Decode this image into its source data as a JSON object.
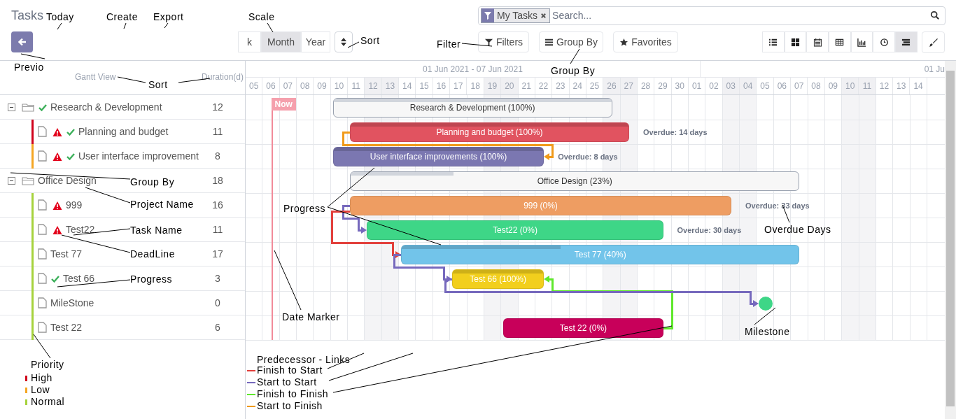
{
  "app_title": "Tasks",
  "callouts": [
    {
      "label": "Today"
    },
    {
      "label": "Create"
    },
    {
      "label": "Export"
    },
    {
      "label": "Scale"
    },
    {
      "label": "Sort"
    },
    {
      "label": "Filter"
    },
    {
      "label": "Group By"
    },
    {
      "label": "Previo"
    },
    {
      "label": "Sort"
    },
    {
      "label": "Group By"
    },
    {
      "label": "Project Name"
    },
    {
      "label": "Task Name"
    },
    {
      "label": "DeadLine"
    },
    {
      "label": "Progress"
    },
    {
      "label": "Progress"
    },
    {
      "label": "Date Marker"
    },
    {
      "label": "Overdue Days"
    },
    {
      "label": "Milestone"
    }
  ],
  "search": {
    "facet": "My Tasks",
    "placeholder": "Search..."
  },
  "scale_buttons": [
    {
      "label": "k",
      "selected": false
    },
    {
      "label": "Month",
      "selected": true
    },
    {
      "label": "Year",
      "selected": false
    }
  ],
  "filter_buttons": [
    {
      "kind": "filter",
      "label": "Filters"
    },
    {
      "kind": "group",
      "label": "Group By"
    },
    {
      "kind": "star",
      "label": "Favorites"
    }
  ],
  "views": [
    {
      "kind": "list",
      "selected": false
    },
    {
      "kind": "kanban",
      "selected": false
    },
    {
      "kind": "calendar",
      "selected": false
    },
    {
      "kind": "pivot",
      "selected": false
    },
    {
      "kind": "graph",
      "selected": false
    },
    {
      "kind": "activity",
      "selected": false
    },
    {
      "kind": "gantt",
      "selected": true
    }
  ],
  "columns": {
    "name": "Gantt View",
    "duration": "Duration(d)"
  },
  "timeline": {
    "ranges": [
      "01 Jun 2021 - 07 Jun 2021",
      "01 Ju"
    ],
    "now_label": "Now",
    "days": [
      {
        "label": "05",
        "weekend": false
      },
      {
        "label": "06",
        "weekend": false
      },
      {
        "label": "07",
        "weekend": false
      },
      {
        "label": "08",
        "weekend": false
      },
      {
        "label": "09",
        "weekend": false
      },
      {
        "label": "10",
        "weekend": false
      },
      {
        "label": "11",
        "weekend": false
      },
      {
        "label": "12",
        "weekend": true
      },
      {
        "label": "13",
        "weekend": true
      },
      {
        "label": "14",
        "weekend": false
      },
      {
        "label": "15",
        "weekend": false
      },
      {
        "label": "16",
        "weekend": false
      },
      {
        "label": "17",
        "weekend": false
      },
      {
        "label": "18",
        "weekend": false
      },
      {
        "label": "19",
        "weekend": true
      },
      {
        "label": "20",
        "weekend": true
      },
      {
        "label": "21",
        "weekend": false
      },
      {
        "label": "22",
        "weekend": false
      },
      {
        "label": "23",
        "weekend": false
      },
      {
        "label": "24",
        "weekend": false
      },
      {
        "label": "25",
        "weekend": false
      },
      {
        "label": "26",
        "weekend": true
      },
      {
        "label": "27",
        "weekend": true
      },
      {
        "label": "28",
        "weekend": false
      },
      {
        "label": "29",
        "weekend": false
      },
      {
        "label": "30",
        "weekend": false
      },
      {
        "label": "01",
        "weekend": false
      },
      {
        "label": "02",
        "weekend": false
      },
      {
        "label": "03",
        "weekend": true
      },
      {
        "label": "04",
        "weekend": true
      },
      {
        "label": "05",
        "weekend": false
      },
      {
        "label": "06",
        "weekend": false
      },
      {
        "label": "07",
        "weekend": false
      },
      {
        "label": "08",
        "weekend": false
      },
      {
        "label": "09",
        "weekend": false
      },
      {
        "label": "10",
        "weekend": true
      },
      {
        "label": "11",
        "weekend": true
      },
      {
        "label": "12",
        "weekend": false
      },
      {
        "label": "13",
        "weekend": false
      },
      {
        "label": "14",
        "weekend": false
      }
    ]
  },
  "rows": [
    {
      "kind": "group",
      "name": "Research & Development",
      "duration": "12",
      "expanded": true,
      "done": true,
      "bar": {
        "label": "Research & Development (100%)",
        "level": 1
      },
      "children": [
        {
          "kind": "task",
          "name": "Planning and budget",
          "duration": "11",
          "color": "#d0021b",
          "overdue": true,
          "done": true,
          "bar": {
            "label": "Planning and budget (100%)",
            "color": "#e15360",
            "level": 1,
            "note": "Overdue: 14 days"
          }
        },
        {
          "kind": "task",
          "name": "User interface improvement",
          "duration": "8",
          "color": "#f5a623",
          "overdue": true,
          "done": true,
          "bar": {
            "label": "User interface improvements (100%)",
            "color": "#7b77b1",
            "level": 1,
            "note": "Overdue: 8 days"
          }
        }
      ]
    },
    {
      "kind": "group",
      "name": "Office Design",
      "duration": "18",
      "expanded": true,
      "done": false,
      "bar": {
        "label": "Office Design (23%)",
        "level": 0.23
      },
      "children": [
        {
          "kind": "task",
          "name": "999",
          "duration": "16",
          "color": "#a6d23c",
          "overdue": true,
          "done": false,
          "bar": {
            "label": "999 (0%)",
            "color": "#ee9d62",
            "level": 0,
            "note": "Overdue: 33 days"
          }
        },
        {
          "kind": "task",
          "name": "Test22",
          "duration": "11",
          "color": "#a6d23c",
          "overdue": true,
          "done": false,
          "bar": {
            "label": "Test22 (0%)",
            "color": "#3ed687",
            "level": 0,
            "note": "Overdue: 30 days"
          }
        },
        {
          "kind": "task",
          "name": "Test 77",
          "duration": "17",
          "color": "#a6d23c",
          "overdue": false,
          "done": false,
          "bar": {
            "label": "Test 77 (40%)",
            "color": "#72c4ea",
            "level": 0.4
          }
        },
        {
          "kind": "task",
          "name": "Test 66",
          "duration": "3",
          "color": "#a6d23c",
          "overdue": false,
          "done": true,
          "bar": {
            "label": "Test 66 (100%)",
            "color": "#f2cf1d",
            "level": 1
          }
        },
        {
          "kind": "milestone",
          "name": "MileStone",
          "duration": "0",
          "color": "#a6d23c",
          "overdue": false,
          "done": false,
          "bar": {
            "color": "#3ed687"
          }
        },
        {
          "kind": "task",
          "name": "Test 22",
          "duration": "6",
          "color": "#a6d23c",
          "overdue": false,
          "done": false,
          "bar": {
            "label": "Test 22 (0%)",
            "color": "#c8005a",
            "level": 0
          }
        }
      ]
    }
  ],
  "links": [
    {
      "color": "#f09a1a"
    },
    {
      "color": "#7669bd"
    },
    {
      "color": "#e2403c"
    },
    {
      "color": "#7669bd"
    },
    {
      "color": "#5fe82c"
    },
    {
      "color": "#7669bd"
    }
  ],
  "priority_legend": {
    "title": "Priority",
    "items": [
      {
        "label": "High",
        "color": "#d0021b"
      },
      {
        "label": "Low",
        "color": "#f5a623"
      },
      {
        "label": "Normal",
        "color": "#a6d23c"
      }
    ]
  },
  "links_legend": {
    "title": "Predecessor - Links",
    "items": [
      {
        "label": "Finish to Start",
        "color": "#e2403c"
      },
      {
        "label": "Start to Start",
        "color": "#7669bd"
      },
      {
        "label": "Finish to Finish",
        "color": "#5fe82c"
      },
      {
        "label": "Start to Finish",
        "color": "#f09a1a"
      }
    ]
  }
}
